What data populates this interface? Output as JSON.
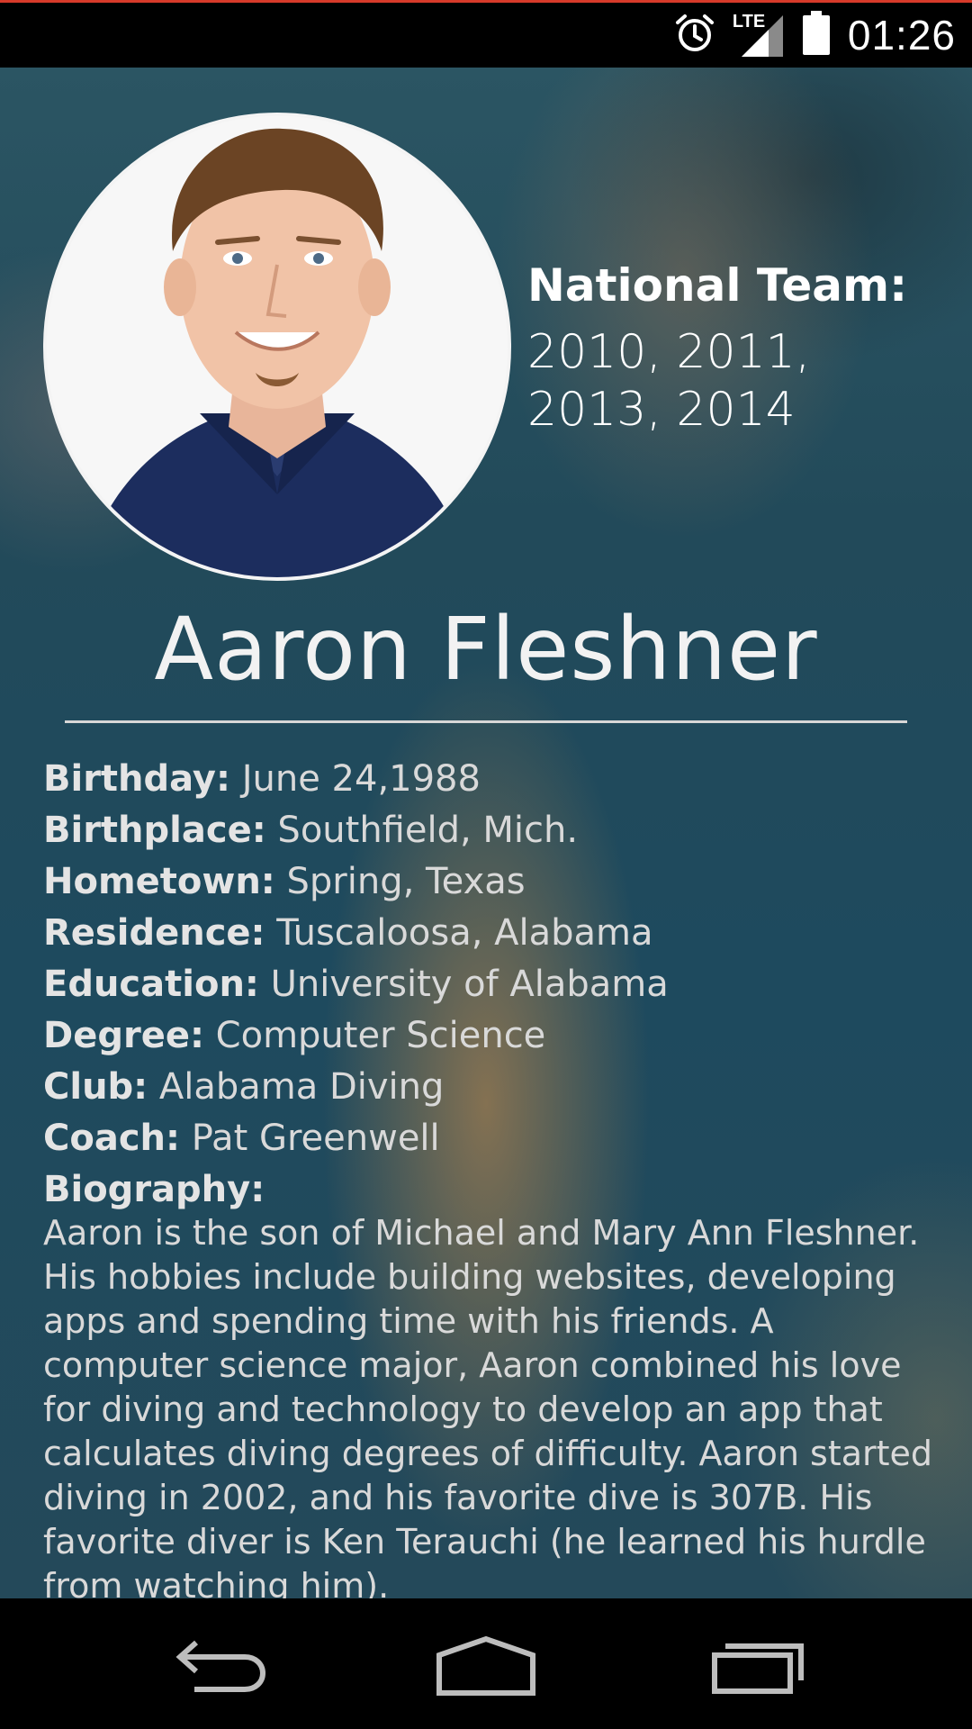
{
  "status_bar": {
    "network": "LTE",
    "time": "01:26"
  },
  "profile": {
    "national_team_label": "National Team:",
    "national_team_years": "2010, 2011, 2013, 2014",
    "name": "Aaron Fleshner",
    "details": [
      {
        "label": "Birthday:",
        "value": "June 24,1988"
      },
      {
        "label": "Birthplace:",
        "value": "Southfield, Mich."
      },
      {
        "label": "Hometown:",
        "value": "Spring, Texas"
      },
      {
        "label": "Residence:",
        "value": "Tuscaloosa, Alabama"
      },
      {
        "label": "Education:",
        "value": "University of Alabama"
      },
      {
        "label": "Degree:",
        "value": "Computer Science"
      },
      {
        "label": "Club:",
        "value": "Alabama Diving"
      },
      {
        "label": "Coach:",
        "value": "Pat Greenwell"
      }
    ],
    "biography_label": "Biography:",
    "biography": "Aaron is the son of Michael and Mary Ann Fleshner. His hobbies include building websites, developing apps and spending time with his friends. A computer science major, Aaron combined his love for diving and technology to develop an app that calculates diving degrees of difficulty. Aaron started diving in 2002, and his favorite dive is 307B. His favorite diver is Ken Terauchi (he learned his hurdle from watching him)."
  },
  "icons": {
    "alarm": "alarm-clock-icon",
    "signal": "signal-icon",
    "battery": "battery-icon",
    "back": "back-icon",
    "home": "home-icon",
    "recents": "recent-apps-icon"
  }
}
